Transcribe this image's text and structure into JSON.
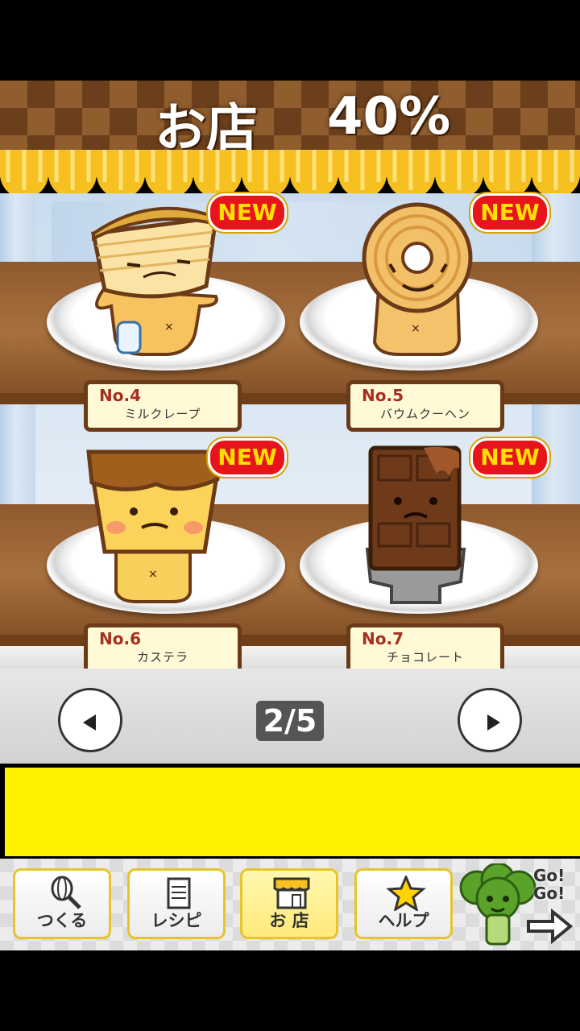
{
  "header": {
    "title": "お店",
    "percent": "40%"
  },
  "items": [
    {
      "number": "No.4",
      "name": "ミルクレープ",
      "badge": "NEW"
    },
    {
      "number": "No.5",
      "name": "バウムクーヘン",
      "badge": "NEW"
    },
    {
      "number": "No.6",
      "name": "カステラ",
      "badge": "NEW"
    },
    {
      "number": "No.7",
      "name": "チョコレート",
      "badge": "NEW"
    }
  ],
  "pagination": {
    "label": "2/5"
  },
  "tabs": [
    {
      "label": "つくる",
      "icon": "whisk-icon"
    },
    {
      "label": "レシピ",
      "icon": "notepad-icon"
    },
    {
      "label": "お 店",
      "icon": "shop-icon"
    },
    {
      "label": "ヘルプ",
      "icon": "star-icon"
    }
  ],
  "gogo": {
    "line1": "Go!",
    "line2": "Go!"
  },
  "colors": {
    "accent": "#e8141b",
    "ad": "#fff200",
    "shelf": "#a7703e"
  }
}
